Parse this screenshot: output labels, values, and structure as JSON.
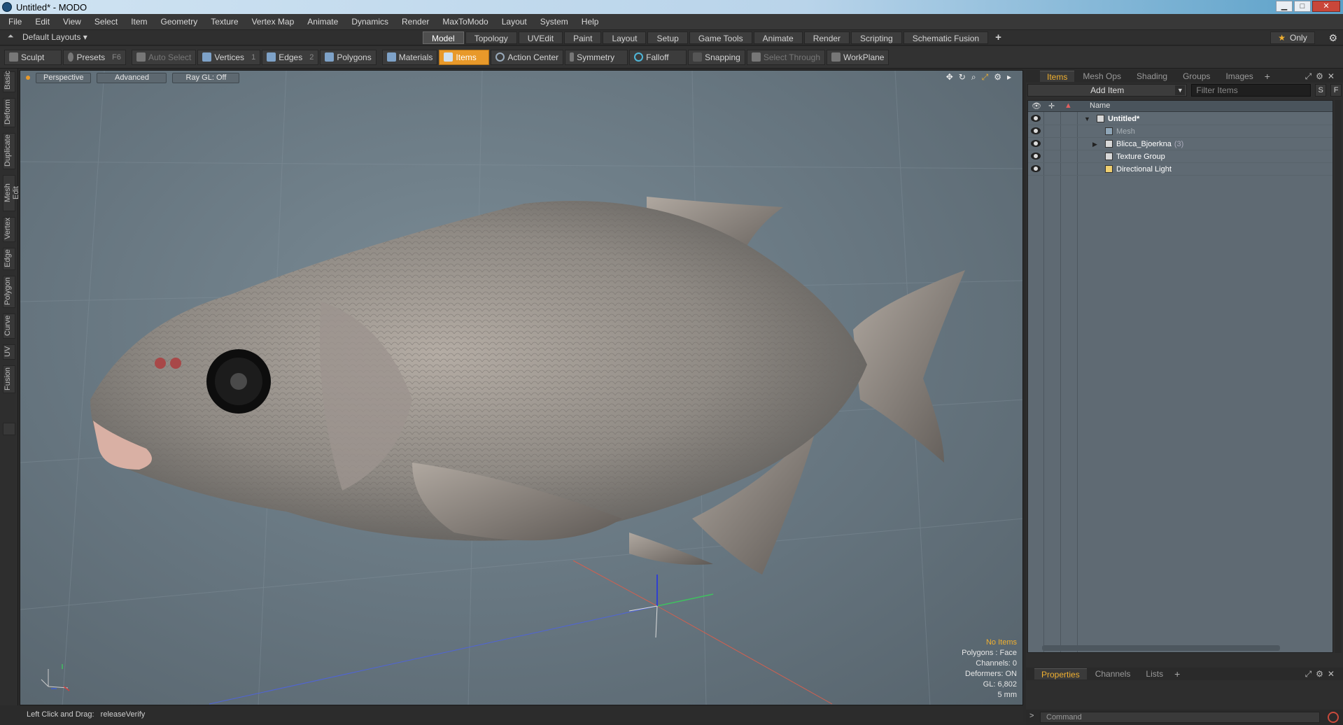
{
  "window": {
    "title": "Untitled* - MODO"
  },
  "menu": [
    "File",
    "Edit",
    "View",
    "Select",
    "Item",
    "Geometry",
    "Texture",
    "Vertex Map",
    "Animate",
    "Dynamics",
    "Render",
    "MaxToModo",
    "Layout",
    "System",
    "Help"
  ],
  "layouts": {
    "label": "Default Layouts ▾"
  },
  "tabs": [
    "Model",
    "Topology",
    "UVEdit",
    "Paint",
    "Layout",
    "Setup",
    "Game Tools",
    "Animate",
    "Render",
    "Scripting",
    "Schematic Fusion"
  ],
  "tab_plus": "+",
  "only_label": "Only",
  "toolbar": {
    "sculpt": "Sculpt",
    "presets": "Presets",
    "presets_key": "F6",
    "auto_select": "Auto Select",
    "vertices": "Vertices",
    "vertices_key": "1",
    "edges": "Edges",
    "edges_key": "2",
    "polygons": "Polygons",
    "materials": "Materials",
    "items": "Items",
    "action_center": "Action Center",
    "symmetry": "Symmetry",
    "falloff": "Falloff",
    "snapping": "Snapping",
    "select_through": "Select Through",
    "workplane": "WorkPlane"
  },
  "left_tabs": [
    "Basic",
    "Deform",
    "Duplicate",
    "Mesh Edit",
    "Vertex",
    "Edge",
    "Polygon",
    "Curve",
    "UV",
    "Fusion"
  ],
  "viewport": {
    "view": "Perspective",
    "shading": "Advanced",
    "raygl": "Ray GL: Off",
    "info": {
      "selection": "No Items",
      "polygons": "Polygons : Face",
      "channels": "Channels: 0",
      "deformers": "Deformers: ON",
      "gl": "GL: 6,802",
      "scale": "5 mm"
    }
  },
  "status": {
    "label": "Left Click and Drag:",
    "value": "releaseVerify"
  },
  "rpanel": {
    "tabs": [
      "Items",
      "Mesh Ops",
      "Shading",
      "Groups",
      "Images"
    ],
    "tab_plus": "+",
    "add_item": "Add Item",
    "filter_placeholder": "Filter Items",
    "s_btn": "S",
    "f_btn": "F",
    "name_col": "Name",
    "items": [
      {
        "name": "Untitled*",
        "style": "bold"
      },
      {
        "name": "Mesh",
        "style": "dim"
      },
      {
        "name": "Blicca_Bjoerkna",
        "count": "(3)",
        "style": "normal"
      },
      {
        "name": "Texture Group",
        "style": "normal"
      },
      {
        "name": "Directional Light",
        "style": "normal"
      }
    ],
    "bottom_tabs": [
      "Properties",
      "Channels",
      "Lists"
    ],
    "bottom_plus": "+",
    "command_placeholder": "Command"
  },
  "colors": {
    "accent": "#e8992a",
    "viewport_bg": "#6a7882",
    "list_bg": "#5f6a73"
  }
}
